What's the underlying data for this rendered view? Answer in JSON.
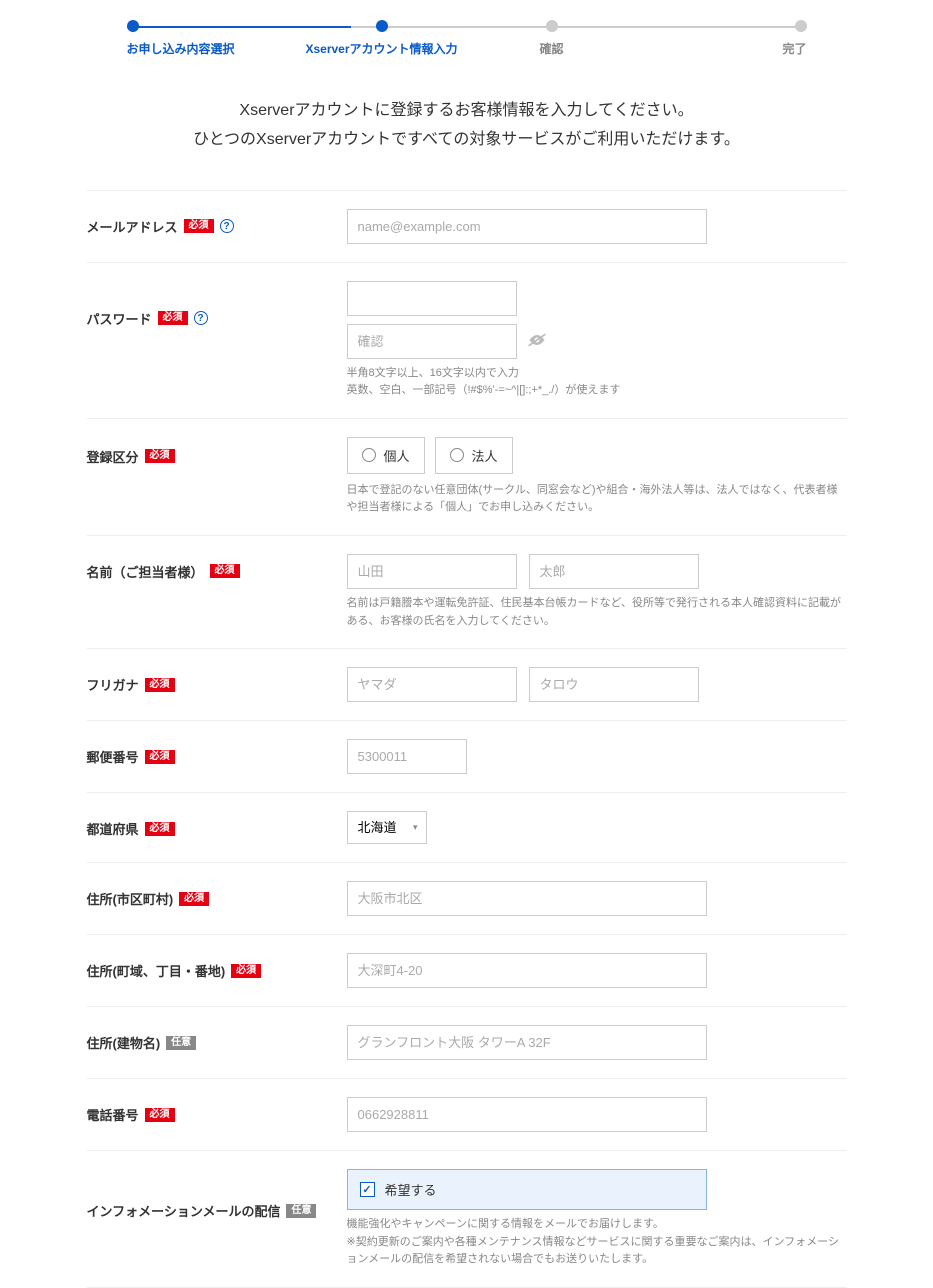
{
  "progress": {
    "steps": [
      {
        "label": "お申し込み内容選択",
        "state": "done"
      },
      {
        "label": "Xserverアカウント情報入力",
        "state": "active"
      },
      {
        "label": "確認",
        "state": ""
      },
      {
        "label": "完了",
        "state": ""
      }
    ]
  },
  "intro": {
    "line1": "Xserverアカウントに登録するお客様情報を入力してください。",
    "line2": "ひとつのXserverアカウントですべての対象サービスがご利用いただけます。"
  },
  "tags": {
    "required": "必須",
    "optional": "任意"
  },
  "fields": {
    "email": {
      "label": "メールアドレス",
      "placeholder": "name@example.com"
    },
    "password": {
      "label": "パスワード",
      "confirm_placeholder": "確認",
      "hint1": "半角8文字以上、16文字以内で入力",
      "hint2": "英数、空白、一部記号（!#$%'-=~^|[]:;+*_./）が使えます"
    },
    "registration_type": {
      "label": "登録区分",
      "option1": "個人",
      "option2": "法人",
      "hint": "日本で登記のない任意団体(サークル、同窓会など)や組合・海外法人等は、法人ではなく、代表者様や担当者様による「個人」でお申し込みください。"
    },
    "name": {
      "label": "名前（ご担当者様）",
      "placeholder_last": "山田",
      "placeholder_first": "太郎",
      "hint": "名前は戸籍謄本や運転免許証、住民基本台帳カードなど、役所等で発行される本人確認資料に記載がある、お客様の氏名を入力してください。"
    },
    "furigana": {
      "label": "フリガナ",
      "placeholder_last": "ヤマダ",
      "placeholder_first": "タロウ"
    },
    "postal": {
      "label": "郵便番号",
      "placeholder": "5300011"
    },
    "prefecture": {
      "label": "都道府県",
      "value": "北海道"
    },
    "city": {
      "label": "住所(市区町村)",
      "placeholder": "大阪市北区"
    },
    "street": {
      "label": "住所(町域、丁目・番地)",
      "placeholder": "大深町4-20"
    },
    "building": {
      "label": "住所(建物名)",
      "placeholder": "グランフロント大阪 タワーA 32F"
    },
    "phone": {
      "label": "電話番号",
      "placeholder": "0662928811"
    },
    "newsletter": {
      "label": "インフォメーションメールの配信",
      "checkbox_label": "希望する",
      "hint1": "機能強化やキャンペーンに関する情報をメールでお届けします。",
      "hint2": "※契約更新のご案内や各種メンテナンス情報などサービスに関する重要なご案内は、インフォメーションメールの配信を希望されない場合でもお送りいたします。"
    }
  }
}
